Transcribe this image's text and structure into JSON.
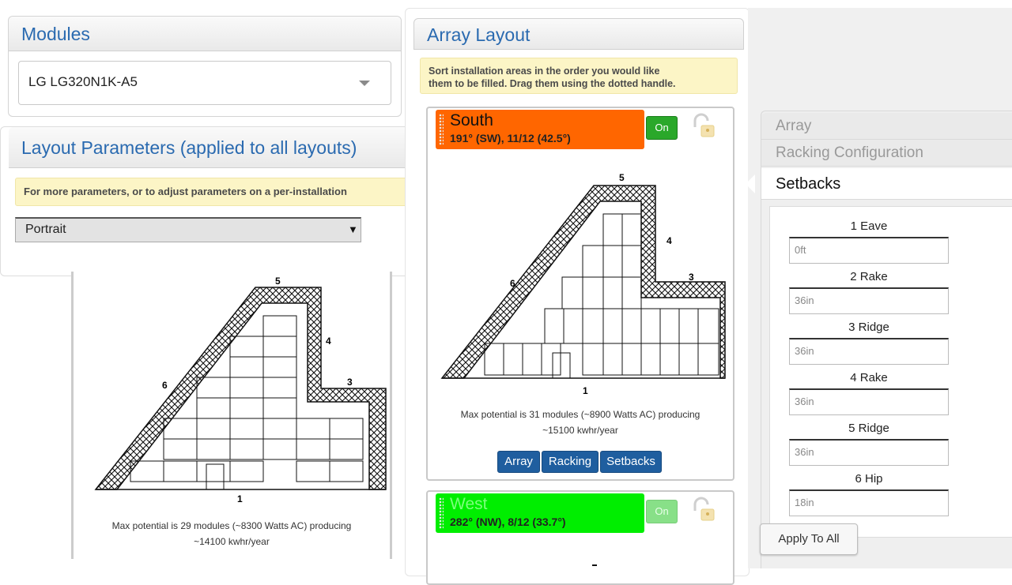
{
  "modules": {
    "title": "Modules",
    "selected_module": "LG LG320N1K-A5"
  },
  "layout_params": {
    "title": "Layout Parameters (applied to all layouts)",
    "notice": "For more parameters, or to adjust parameters on a per-installation",
    "orientation": "Portrait"
  },
  "left_preview": {
    "edge_labels": [
      "1",
      "3",
      "4",
      "5",
      "6"
    ],
    "caption_line1": "Max potential is 29 modules (~8300 Watts AC) producing",
    "caption_line2": "~14100 kwhr/year"
  },
  "array_layout": {
    "title": "Array Layout",
    "notice_line1": "Sort installation areas in the order you would like",
    "notice_line2": "them to be filled. Drag them using the dotted handle."
  },
  "south_card": {
    "name": "South",
    "details": "191° (SW), 11/12 (42.5°)",
    "toggle": "On",
    "edge_labels": [
      "1",
      "3",
      "4",
      "5",
      "6"
    ],
    "caption_line1": "Max potential is 31 modules (~8900 Watts AC) producing",
    "caption_line2": "~15100 kwhr/year",
    "buttons": [
      "Array",
      "Racking",
      "Setbacks"
    ],
    "head_color": "#ff6600"
  },
  "west_card": {
    "name": "West",
    "details": "282° (NW), 8/12 (33.7°)",
    "toggle": "On",
    "head_color": "#00ee00"
  },
  "side_panel": {
    "tabs": [
      "Array",
      "Racking Configuration",
      "Setbacks"
    ],
    "active_tab": "Setbacks",
    "fields": [
      {
        "label": "1 Eave",
        "value": "0ft"
      },
      {
        "label": "2 Rake",
        "value": "36in"
      },
      {
        "label": "3 Ridge",
        "value": "36in"
      },
      {
        "label": "4 Rake",
        "value": "36in"
      },
      {
        "label": "5 Ridge",
        "value": "36in"
      },
      {
        "label": "6 Hip",
        "value": "18in"
      }
    ],
    "apply_label": "Apply To All"
  }
}
